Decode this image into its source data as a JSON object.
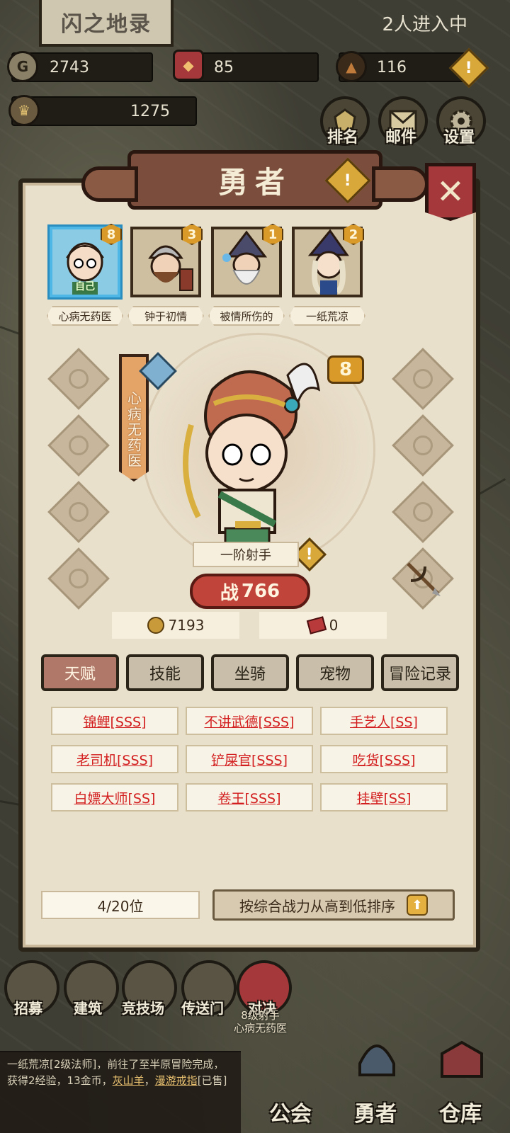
{
  "hud": {
    "sign": "闪之地录",
    "online": "2人进入中",
    "gold": "2743",
    "badge": "85",
    "shards": "116",
    "power": "1275",
    "buttons": [
      "排名",
      "邮件",
      "设置"
    ]
  },
  "panel": {
    "title": "勇者",
    "close": "✕",
    "heroes": [
      {
        "name": "心病无药医",
        "level": "8",
        "tag": "自己",
        "selected": true
      },
      {
        "name": "钟于初情",
        "level": "3"
      },
      {
        "name": "被情所伤的",
        "level": "1"
      },
      {
        "name": "一纸荒凉",
        "level": "2"
      }
    ],
    "hero_name_vertical": "心病无药医",
    "hero_level": "8",
    "class": "一阶射手",
    "power_prefix": "战",
    "power": "766",
    "coins": "7193",
    "tickets": "0",
    "tabs": [
      "天赋",
      "技能",
      "坐骑",
      "宠物",
      "冒险记录"
    ],
    "active_tab": "天赋",
    "talents": [
      "锦鲤[SSS]",
      "不讲武德[SSS]",
      "手艺人[SS]",
      "老司机[SSS]",
      "铲屎官[SSS]",
      "吃货[SSS]",
      "白嫖大师[SS]",
      "卷王[SSS]",
      "挂壁[SS]"
    ],
    "count": "4/20位",
    "sort_label": "按综合战力从高到低排序",
    "sort_arrow": "⬆"
  },
  "nav": {
    "circles": [
      "招募",
      "建筑",
      "竞技场",
      "传送门",
      "对决"
    ],
    "bottom": [
      "公会",
      "勇者",
      "仓库"
    ]
  },
  "chat": {
    "text": "一纸荒凉[2级法师]，前往了至半原冒险完成，获得2经验，13金币，",
    "link1": "灰山羊",
    "sep": "，",
    "link2": "漫游戒指",
    "suffix": "[已售]"
  },
  "floating": {
    "line1": "8级射手",
    "line2": "心病无药医"
  },
  "colors": {
    "accent": "#b07868",
    "talent_text": "#d21e1e",
    "selected_border": "#4fb7e6"
  }
}
